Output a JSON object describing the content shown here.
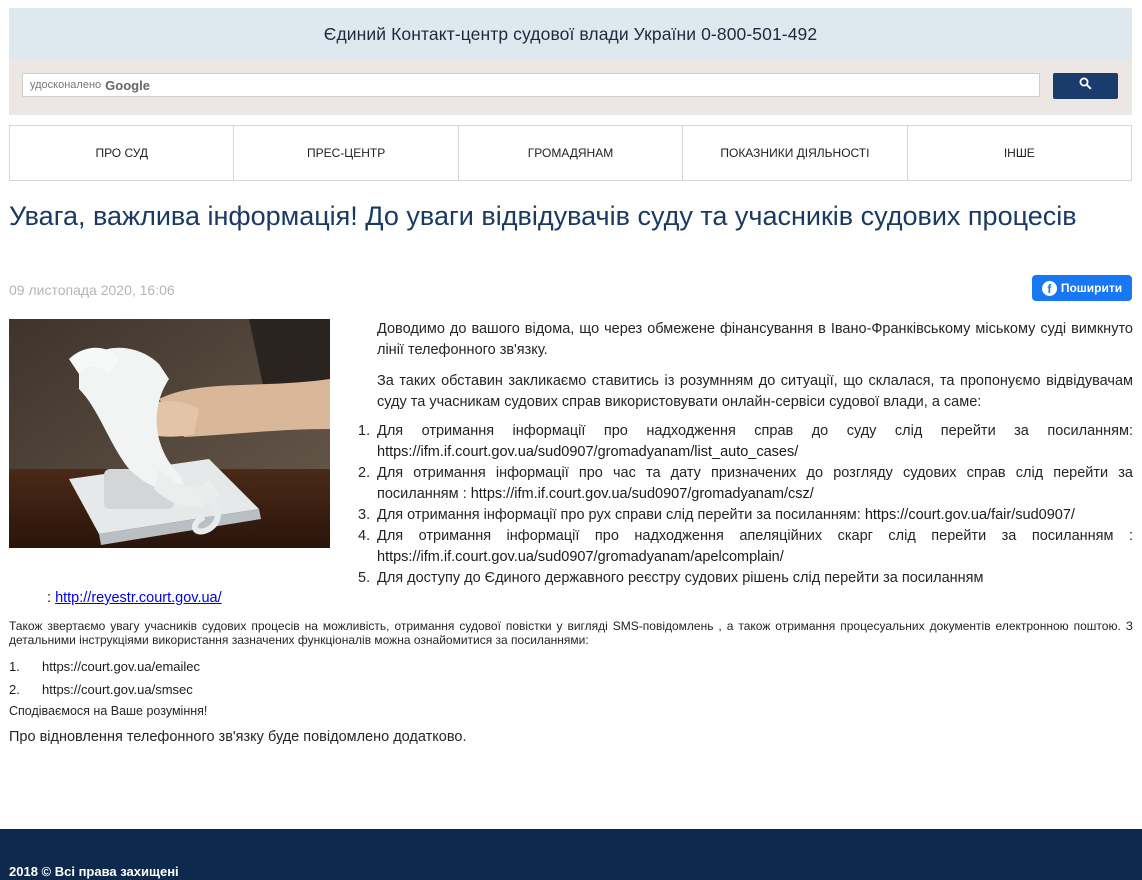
{
  "header": {
    "contact_center": "Єдиний Контакт-центр судової влади України 0-800-501-492"
  },
  "search": {
    "enhanced_label": "удосконалено",
    "google_label": "Google",
    "button_icon": "search-icon"
  },
  "nav": {
    "items": [
      {
        "label": "ПРО СУД"
      },
      {
        "label": "ПРЕС-ЦЕНТР"
      },
      {
        "label": "ГРОМАДЯНАМ"
      },
      {
        "label": "ПОКАЗНИКИ ДІЯЛЬНОСТІ"
      },
      {
        "label": "ІНШЕ"
      }
    ]
  },
  "article": {
    "title": "Увага, важлива інформація! До уваги відвідувачів суду та учасників судових процесів",
    "date": "09 листопада 2020, 16:06",
    "share_label": "Поширити",
    "intro_1": "Доводимо до вашого відома, що через обмежене фінансування в Івано-Франківському міському суді вимкнуто лінії телефонного зв'язку.",
    "intro_2": "За таких обставин закликаємо ставитись із розумнням до ситуації, що склалася, та пропонуємо відвідувачам суду та учасникам судових справ використовувати онлайн-сервіси судової влади, а саме:",
    "services": [
      {
        "num": "1.",
        "text": "Для отримання інформації про надходження справ до суду слід перейти за посиланням: ",
        "link": "https://ifm.if.court.gov.ua/sud0907/gromadyanam/list_auto_cases/"
      },
      {
        "num": "2.",
        "text": "Для отримання інформації про час та дату призначених до розгляду судових справ слід перейти за посиланням : ",
        "link": "https://ifm.if.court.gov.ua/sud0907/gromadyanam/csz/"
      },
      {
        "num": "3.",
        "text": "Для отримання інформації про рух справи слід перейти за посиланням: ",
        "link": "https://court.gov.ua/fair/sud0907/"
      },
      {
        "num": "4.",
        "text": "Для отримання інформації про надходження апеляційних скарг слід перейти за посиланням : ",
        "link": "https://ifm.if.court.gov.ua/sud0907/gromadyanam/apelcomplain/"
      },
      {
        "num": "5.",
        "text": "Для доступу до Єдиного державного реєстру судових рішень слід перейти за посиланням"
      }
    ],
    "registry_link_prefix": ": ",
    "registry_link": "http://reyestr.court.gov.ua/",
    "note": "Також звертаємо увагу учасників судових процесів на можливість, отримання  судової повістки у вигляді SMS-повідомлень ,   а також отримання процесуальних документів електронною поштою. З детальними інструкціями використання зазначених функціоналів  можна ознайомитися за посиланнями:",
    "instruction_links": [
      {
        "num": "1.",
        "link": "https://court.gov.ua/emailec"
      },
      {
        "num": "2.",
        "link": "https://court.gov.ua/smsec"
      }
    ],
    "hope": "Сподіваємося на Ваше розуміння!",
    "final": "Про відновлення телефонного зв'язку буде повідомлено додатково."
  },
  "footer": {
    "copyright": "2018 © Всі права захищені"
  },
  "colors": {
    "banner": "#dde8ef",
    "search_strip": "#ece6e4",
    "search_button": "#1a3c6d",
    "title": "#1b3a62",
    "facebook": "#1877f2",
    "footer": "#0d2a4d"
  }
}
